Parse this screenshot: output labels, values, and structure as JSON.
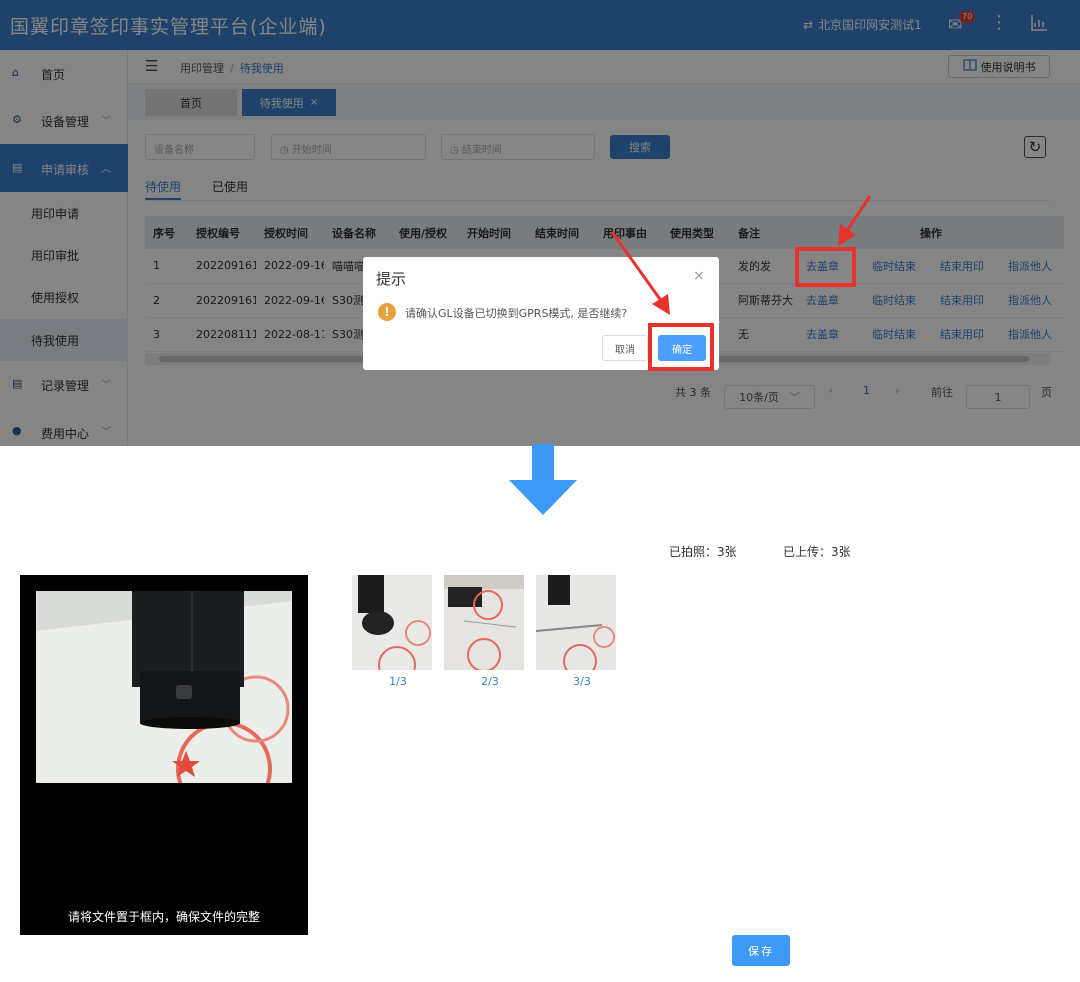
{
  "app": {
    "title": "国翼印章签印事实管理平台(企业端)",
    "org_name": "北京国印网安测试1",
    "mail_count": "70",
    "icons": [
      "switch-icon",
      "mail-icon",
      "more-vertical-icon",
      "chart-icon"
    ]
  },
  "sidebar": {
    "home": "首页",
    "device_mgmt": "设备管理",
    "apply_review": "申请审核",
    "sub_items": [
      "用印申请",
      "用印审批",
      "使用授权",
      "待我使用"
    ],
    "records": "记录管理",
    "fees": "费用中心"
  },
  "breadcrumb": {
    "parent": "用印管理",
    "sep": "/",
    "current": "待我使用"
  },
  "manual_button": "使用说明书",
  "tabs": {
    "home": "首页",
    "current": "待我使用",
    "close": "×"
  },
  "filters": {
    "device_placeholder": "设备名称",
    "start_placeholder": "开始时间",
    "end_placeholder": "结束时间",
    "search_button": "搜索"
  },
  "subtabs": {
    "pending": "待使用",
    "used": "已使用"
  },
  "table": {
    "headers": [
      "序号",
      "授权编号",
      "授权时间",
      "设备名称",
      "使用/授权",
      "开始时间",
      "结束时间",
      "用印事由",
      "使用类型",
      "备注",
      "操作"
    ],
    "rows": [
      {
        "no": "1",
        "auth_no": "202209161",
        "auth_time": "2022-09-16",
        "device": "喵喵喵",
        "remark": "发的发"
      },
      {
        "no": "2",
        "auth_no": "202209161",
        "auth_time": "2022-09-16",
        "device": "S30测",
        "remark": "阿斯蒂芬大"
      },
      {
        "no": "3",
        "auth_no": "202208111",
        "auth_time": "2022-08-11",
        "device": "S30测",
        "remark": "无"
      }
    ],
    "actions": [
      "去盖章",
      "临时结束",
      "结束用印",
      "指派他人"
    ]
  },
  "pager": {
    "total": "共 3 条",
    "page_size": "10条/页",
    "prev": "‹",
    "page": "1",
    "next": "›",
    "goto_label": "前往",
    "goto_value": "1",
    "page_suffix": "页"
  },
  "dialog": {
    "title": "提示",
    "close": "×",
    "warn_icon": "!",
    "message": "请确认GL设备已切换到GPRS模式, 是否继续?",
    "cancel": "取消",
    "confirm": "确定"
  },
  "upload": {
    "photographed": "已拍照：3张",
    "uploaded": "已上传：3张",
    "camera_hint": "请将文件置于框内，确保文件的完整",
    "thumbs": [
      "1/3",
      "2/3",
      "3/3"
    ],
    "save": "保存"
  },
  "colors": {
    "primary": "#3c7fcd",
    "highlight": "#e8322c",
    "arrow": "#3c99f5",
    "warning": "#e6a23c"
  }
}
